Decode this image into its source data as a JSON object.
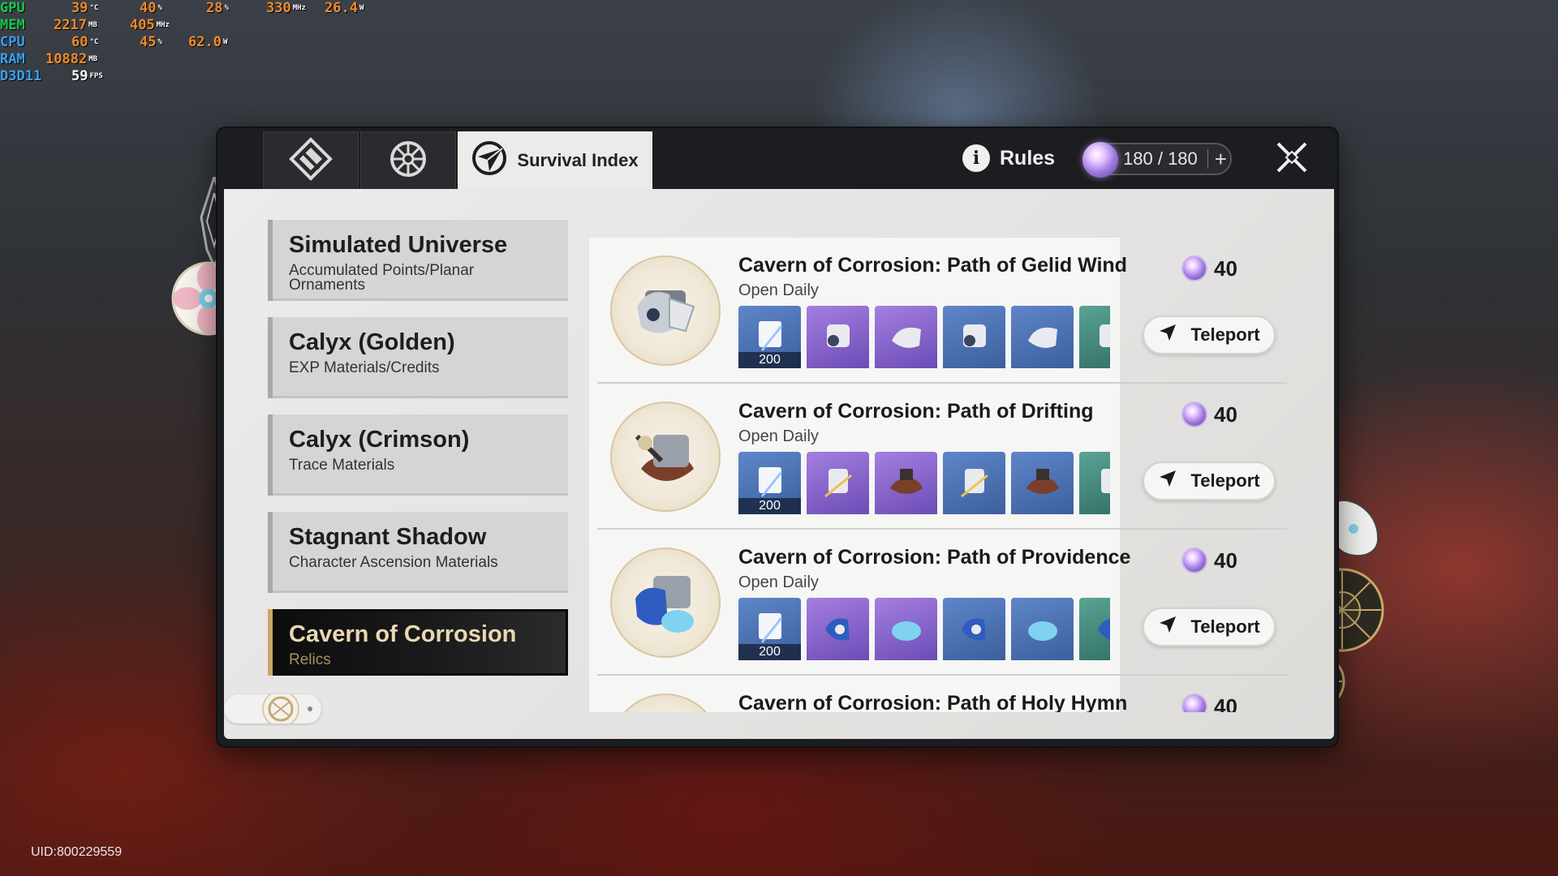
{
  "overlay": {
    "gpu": {
      "label": "GPU",
      "temp": "39",
      "temp_unit": "°C",
      "load": "40",
      "load_unit": "%",
      "fan": "28",
      "fan_unit": "%",
      "clock": "330",
      "clock_unit": "MHz",
      "power": "26.4",
      "power_unit": "W"
    },
    "mem": {
      "label": "MEM",
      "used": "2217",
      "used_unit": "MB",
      "clock": "405",
      "clock_unit": "MHz"
    },
    "cpu": {
      "label": "CPU",
      "temp": "60",
      "temp_unit": "°C",
      "load": "45",
      "load_unit": "%",
      "power": "62.0",
      "power_unit": "W"
    },
    "ram": {
      "label": "RAM",
      "used": "10882",
      "used_unit": "MB"
    },
    "d3d": {
      "label": "D3D11",
      "fps": "59",
      "fps_unit": "FPS"
    }
  },
  "uid": "UID:800229559",
  "header": {
    "tabs": [
      {
        "icon": "diamond-tab-icon"
      },
      {
        "icon": "compass-tab-icon"
      },
      {
        "icon": "survival-index-icon",
        "label": "Survival Index"
      }
    ],
    "rules_label": "Rules",
    "power": {
      "current": "180",
      "separator": " / ",
      "max": "180",
      "plus": "+"
    }
  },
  "categories": [
    {
      "title": "Simulated Universe",
      "subtitle": "Accumulated Points/Planar Ornaments"
    },
    {
      "title": "Calyx (Golden)",
      "subtitle": "EXP Materials/Credits"
    },
    {
      "title": "Calyx (Crimson)",
      "subtitle": "Trace Materials"
    },
    {
      "title": "Stagnant Shadow",
      "subtitle": "Character Ascension Materials"
    },
    {
      "title": "Cavern of Corrosion",
      "subtitle": "Relics",
      "active": true
    }
  ],
  "domains": [
    {
      "title": "Cavern of Corrosion: Path of Gelid Wind",
      "subtitle": "Open Daily",
      "cost": "40",
      "teleport_label": "Teleport",
      "first_item_count": "200"
    },
    {
      "title": "Cavern of Corrosion: Path of Drifting",
      "subtitle": "Open Daily",
      "cost": "40",
      "teleport_label": "Teleport",
      "first_item_count": "200"
    },
    {
      "title": "Cavern of Corrosion: Path of Providence",
      "subtitle": "Open Daily",
      "cost": "40",
      "teleport_label": "Teleport",
      "first_item_count": "200"
    },
    {
      "title": "Cavern of Corrosion: Path of Holy Hymn",
      "cost": "40"
    }
  ],
  "colors": {
    "accent_gold": "#c9a96a",
    "panel_dark": "#1c1d20",
    "panel_light": "#ecebea",
    "item_blue": "#4a6fb0",
    "item_purple": "#8a63cc"
  }
}
